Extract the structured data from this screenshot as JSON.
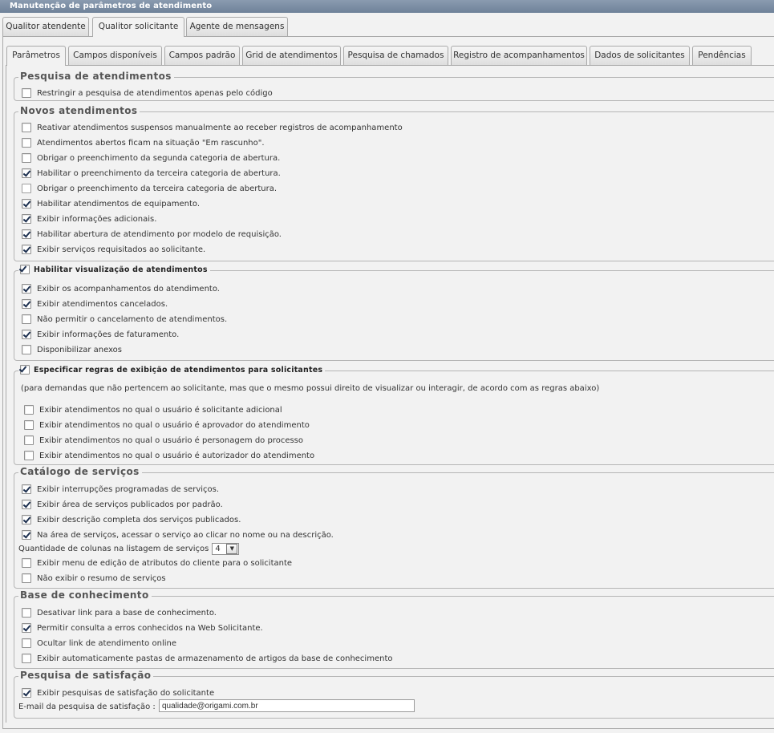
{
  "window": {
    "title": "Manutenção de parâmetros de atendimento"
  },
  "outer_tabs": [
    "Qualitor atendente",
    "Qualitor solicitante",
    "Agente de mensagens"
  ],
  "inner_tabs": [
    "Parâmetros",
    "Campos disponíveis",
    "Campos padrão",
    "Grid de atendimentos",
    "Pesquisa de chamados",
    "Registro de acompanhamentos",
    "Dados de solicitantes",
    "Pendências"
  ],
  "sections": {
    "pesquisa": {
      "legend": "Pesquisa de atendimentos",
      "items": [
        {
          "label": "Restringir a pesquisa de atendimentos apenas pelo código",
          "checked": false
        }
      ]
    },
    "novos": {
      "legend": "Novos atendimentos",
      "items": [
        {
          "label": "Reativar atendimentos suspensos manualmente ao receber registros de acompanhamento",
          "checked": false
        },
        {
          "label": "Atendimentos abertos ficam na situação \"Em rascunho\".",
          "checked": false
        },
        {
          "label": "Obrigar o preenchimento da segunda categoria de abertura.",
          "checked": false
        },
        {
          "label": "Habilitar o preenchimento da terceira categoria de abertura.",
          "checked": true
        },
        {
          "label": "Obrigar o preenchimento da terceira categoria de abertura.",
          "checked": false
        },
        {
          "label": "Habilitar atendimentos de equipamento.",
          "checked": true
        },
        {
          "label": "Exibir informações adicionais.",
          "checked": true
        },
        {
          "label": "Habilitar abertura de atendimento por modelo de requisição.",
          "checked": true
        },
        {
          "label": "Exibir serviços requisitados ao solicitante.",
          "checked": true
        }
      ]
    },
    "visualizacao": {
      "legend": "Habilitar visualização de atendimentos",
      "legend_checked": true,
      "items": [
        {
          "label": "Exibir os acompanhamentos do atendimento.",
          "checked": true
        },
        {
          "label": "Exibir atendimentos cancelados.",
          "checked": true
        },
        {
          "label": "Não permitir o cancelamento de atendimentos.",
          "checked": false
        },
        {
          "label": "Exibir informações de faturamento.",
          "checked": true
        },
        {
          "label": "Disponibilizar anexos",
          "checked": false
        }
      ]
    },
    "regras": {
      "legend": "Especificar regras de exibição de atendimentos para solicitantes",
      "legend_checked": true,
      "note": "(para demandas que não pertencem ao solicitante, mas que o mesmo possui direito de visualizar ou interagir, de acordo com as regras abaixo)",
      "items": [
        {
          "label": "Exibir atendimentos no qual o usuário é solicitante adicional",
          "checked": false
        },
        {
          "label": "Exibir atendimentos no qual o usuário é aprovador do atendimento",
          "checked": false
        },
        {
          "label": "Exibir atendimentos no qual o usuário é personagem do processo",
          "checked": false
        },
        {
          "label": "Exibir atendimentos no qual o usuário é autorizador do atendimento",
          "checked": false
        }
      ]
    },
    "catalogo": {
      "legend": "Catálogo de serviços",
      "items": [
        {
          "label": "Exibir interrupções programadas de serviços.",
          "checked": true
        },
        {
          "label": "Exibir área de serviços publicados por padrão.",
          "checked": true
        },
        {
          "label": "Exibir descrição completa dos serviços publicados.",
          "checked": true
        },
        {
          "label": "Na área de serviços, acessar o serviço ao clicar no nome ou na descrição.",
          "checked": true
        }
      ],
      "columns_label": "Quantidade de colunas na listagem de serviços",
      "columns_value": "4",
      "items2": [
        {
          "label": "Exibir menu de edição de atributos do cliente para o solicitante",
          "checked": false
        },
        {
          "label": "Não exibir o resumo de serviços",
          "checked": false
        }
      ]
    },
    "conhecimento": {
      "legend": "Base de conhecimento",
      "items": [
        {
          "label": "Desativar link para a base de conhecimento.",
          "checked": false
        },
        {
          "label": "Permitir consulta a erros conhecidos na Web Solicitante.",
          "checked": true
        },
        {
          "label": "Ocultar link de atendimento online",
          "checked": false
        },
        {
          "label": "Exibir automaticamente pastas de armazenamento de artigos da base de conhecimento",
          "checked": false
        }
      ]
    },
    "satisfacao": {
      "legend": "Pesquisa de satisfação",
      "items": [
        {
          "label": "Exibir pesquisas de satisfação do solicitante",
          "checked": true
        }
      ],
      "email_label": "E-mail da pesquisa de satisfação :",
      "email_value": "qualidade@origami.com.br"
    }
  }
}
